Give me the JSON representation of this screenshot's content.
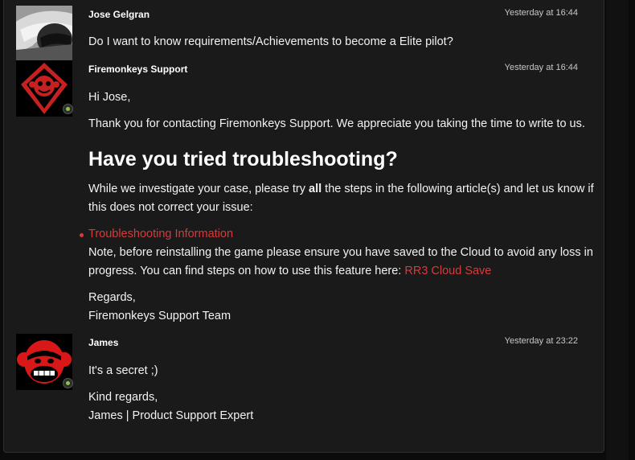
{
  "colors": {
    "background": "#1a1a1a",
    "link": "#d63b3b",
    "agent_badge": "#8bc34a"
  },
  "messages": [
    {
      "author": "Jose Gelgran",
      "time": "Yesterday at 16:44",
      "avatar_icon": "helmet-avatar",
      "body": "Do I want to know requirements/Achievements to become a Elite pilot?"
    },
    {
      "author": "Firemonkeys Support",
      "time": "Yesterday at 16:44",
      "avatar_icon": "firemonkeys-logo-avatar",
      "greeting": "Hi Jose,",
      "intro": "Thank you for contacting Firemonkeys Support. We appreciate you taking the time to write to us.",
      "heading": "Have you tried troubleshooting?",
      "investigate_pre": "While we investigate your case, please try ",
      "investigate_bold": "all",
      "investigate_post": " the steps in the following article(s) and let us know if",
      "investigate_line2": "this does not correct your issue:",
      "bullet_link": "Troubleshooting Information",
      "note_line1": "Note, before reinstalling the game please ensure you have saved to the Cloud to avoid any loss in",
      "note_line2_pre": "progress. You can find steps on how to use this feature here: ",
      "note_link": "RR3 Cloud Save",
      "sign_1": "Regards,",
      "sign_2": "Firemonkeys Support Team"
    },
    {
      "author": "James",
      "time": "Yesterday at 23:22",
      "avatar_icon": "monkey-face-avatar",
      "body": "It's a secret ;)",
      "sign_1": "Kind regards,",
      "sign_2": "James | Product Support Expert"
    }
  ]
}
